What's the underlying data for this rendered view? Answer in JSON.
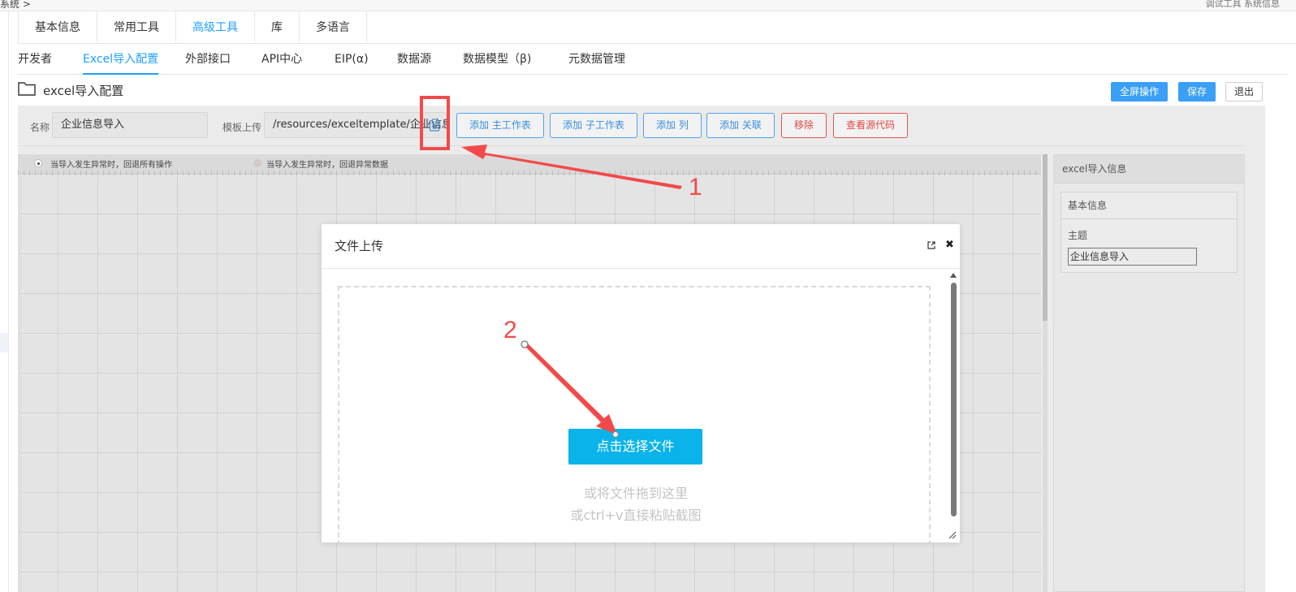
{
  "topbar": {
    "left_text": "系统 >",
    "right_text": "调试工具  系统信息"
  },
  "tabs_primary": [
    {
      "label": "基本信息",
      "active": false
    },
    {
      "label": "常用工具",
      "active": false
    },
    {
      "label": "高级工具",
      "active": true
    },
    {
      "label": "库",
      "active": false
    },
    {
      "label": "多语言",
      "active": false
    }
  ],
  "tabs_secondary": [
    {
      "label": "开发者",
      "active": false
    },
    {
      "label": "Excel导入配置",
      "active": true
    },
    {
      "label": "外部接口",
      "active": false
    },
    {
      "label": "API中心",
      "active": false
    },
    {
      "label": "EIP(α)",
      "active": false
    },
    {
      "label": "数据源",
      "active": false
    },
    {
      "label": "数据模型（β)",
      "active": false
    },
    {
      "label": "元数据管理",
      "active": false
    }
  ],
  "header": {
    "title": "excel导入配置",
    "fullscreen_label": "全屏操作",
    "save_label": "保存",
    "exit_label": "退出"
  },
  "form": {
    "name_label": "名称",
    "name_value": "企业信息导入",
    "template_label": "模板上传",
    "template_value": "/resources/exceltemplate/企业信息导入.xlsx"
  },
  "toolbar": {
    "add_main_sheet": "添加 主工作表",
    "add_sub_sheet": "添加 子工作表",
    "add_column": "添加 列",
    "add_relation": "添加 关联",
    "remove": "移除",
    "view_source": "查看源代码"
  },
  "options": {
    "rollback_all": "当导入发生异常时，回退所有操作",
    "rollback_error": "当导入发生异常时，回退异常数据",
    "selected": "rollback_all"
  },
  "right_panel": {
    "title": "excel导入信息",
    "section_title": "基本信息",
    "subject_label": "主题",
    "subject_value": "企业信息导入"
  },
  "modal": {
    "title": "文件上传",
    "choose_button": "点击选择文件",
    "hint_drag": "或将文件拖到这里",
    "hint_paste": "或ctrl+v直接粘贴截图"
  },
  "annotations": {
    "step1": "1",
    "step2": "2",
    "color": "#f24a4a"
  },
  "colors": {
    "accent": "#1e9fff",
    "upload_button": "#0ab3ea",
    "danger": "#e04848"
  }
}
